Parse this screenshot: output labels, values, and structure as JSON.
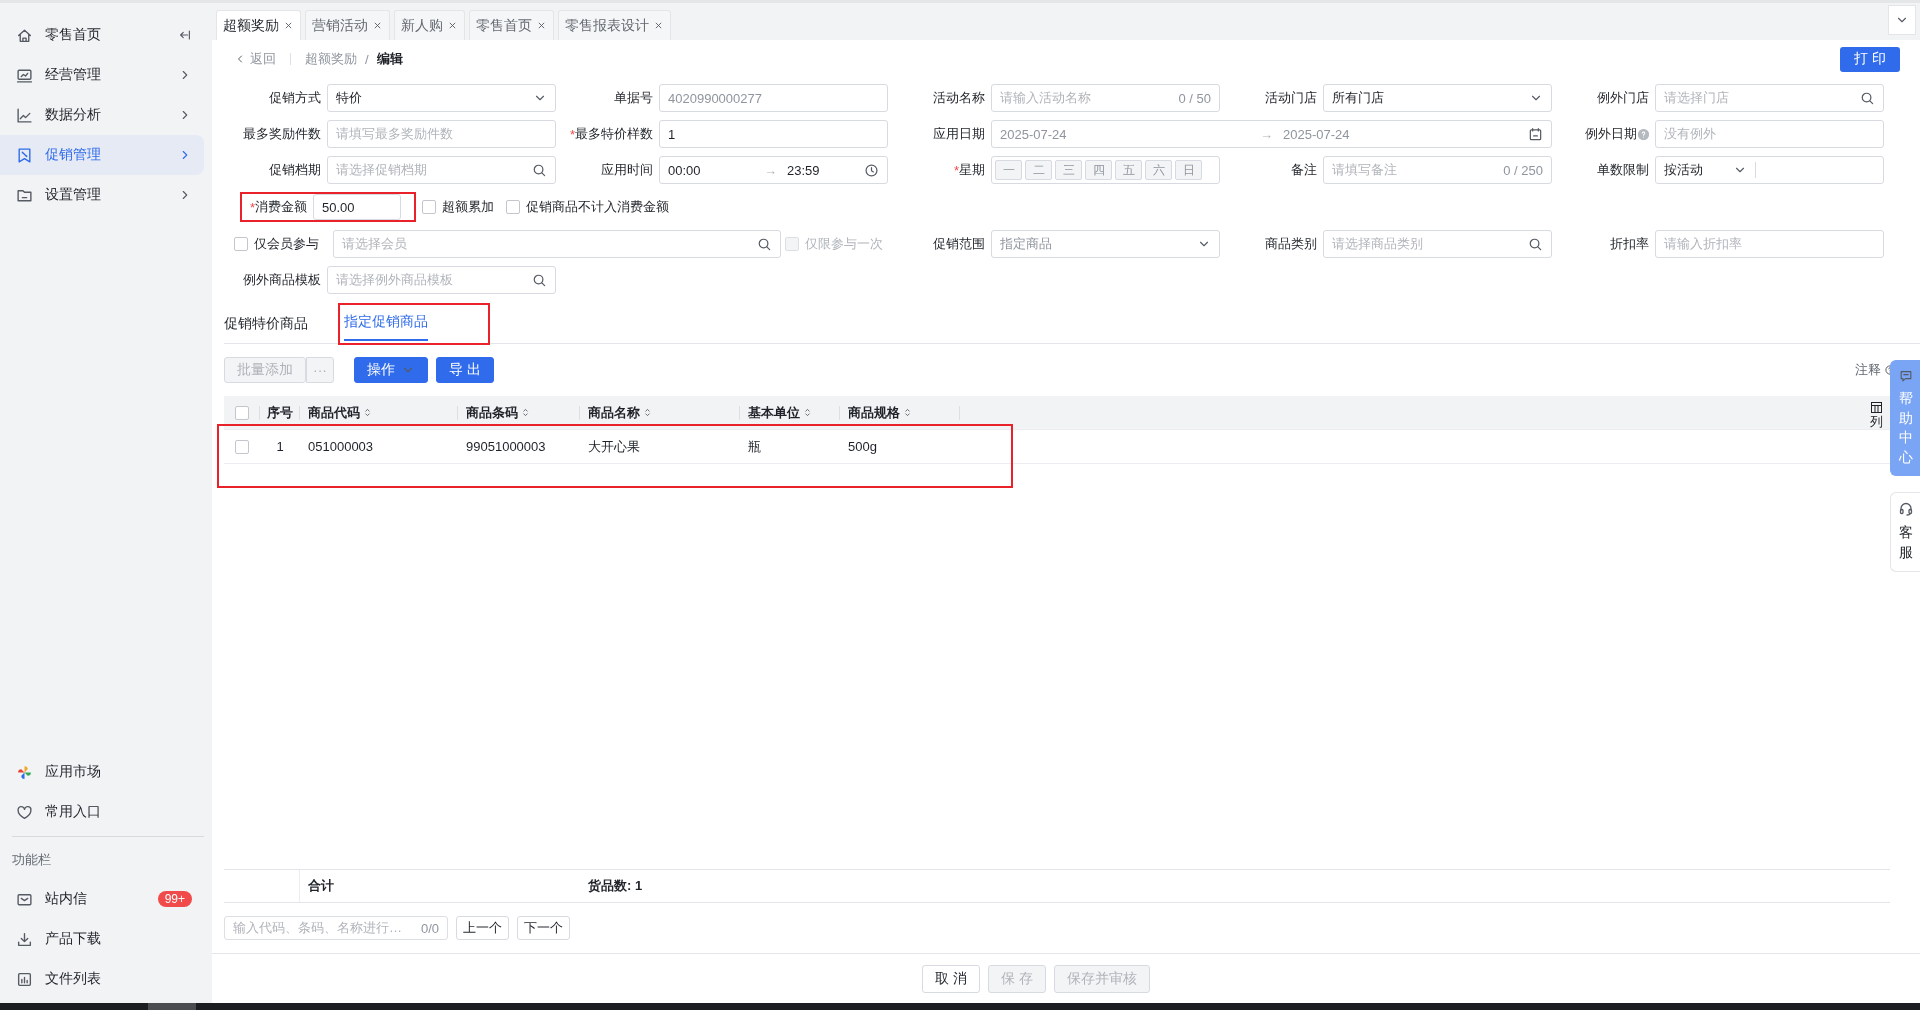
{
  "sidebar": {
    "nav": [
      {
        "label": "零售首页",
        "selected": false
      },
      {
        "label": "经营管理",
        "selected": false
      },
      {
        "label": "数据分析",
        "selected": false
      },
      {
        "label": "促销管理",
        "selected": true
      },
      {
        "label": "设置管理",
        "selected": false
      }
    ],
    "shortcuts": [
      {
        "label": "应用市场"
      },
      {
        "label": "常用入口"
      }
    ],
    "section_title": "功能栏",
    "tools": [
      {
        "label": "站内信",
        "badge": "99+"
      },
      {
        "label": "产品下载"
      },
      {
        "label": "文件列表"
      }
    ]
  },
  "tabs": [
    {
      "label": "超额奖励",
      "selected": true
    },
    {
      "label": "营销活动",
      "selected": false
    },
    {
      "label": "新人购",
      "selected": false
    },
    {
      "label": "零售首页",
      "selected": false
    },
    {
      "label": "零售报表设计",
      "selected": false
    }
  ],
  "breadcrumb": {
    "back": "返回",
    "items": [
      "超额奖励",
      "编辑"
    ],
    "separator": "/"
  },
  "print_button": "打 印",
  "form": {
    "rows": [
      [
        {
          "kind": "select",
          "label": "促销方式",
          "value": "特价"
        },
        {
          "kind": "input",
          "label": "单据号",
          "value": "4020990000277",
          "disabled": true
        },
        {
          "kind": "counter",
          "label": "活动名称",
          "placeholder": "请输入活动名称",
          "count": "0 / 50"
        },
        {
          "kind": "select",
          "label": "活动门店",
          "value": "所有门店"
        },
        {
          "kind": "search",
          "label": "例外门店",
          "placeholder": "请选择门店"
        }
      ],
      [
        {
          "kind": "input",
          "label": "最多奖励件数",
          "placeholder": "请填写最多奖励件数"
        },
        {
          "kind": "input",
          "label": "最多特价样数",
          "mark": "*",
          "value": "1"
        },
        {
          "kind": "daterange",
          "label": "应用日期",
          "start": "2025-07-24",
          "arrow": "→",
          "end": "2025-07-24"
        },
        "",
        "",
        {
          "kind": "input",
          "label": "例外日期",
          "help": true,
          "placeholder": "没有例外"
        }
      ],
      [
        {
          "kind": "search",
          "label": "促销档期",
          "placeholder": "请选择促销档期"
        },
        {
          "kind": "timerange",
          "label": "应用时间",
          "start": "00:00",
          "arrow": "→",
          "end": "23:59"
        },
        {
          "kind": "weekdays",
          "label": "星期",
          "mark": "*",
          "days": [
            "一",
            "二",
            "三",
            "四",
            "五",
            "六",
            "日"
          ]
        },
        {
          "kind": "counter",
          "label": "备注",
          "placeholder": "请填写备注",
          "count": "0 / 250"
        },
        {
          "kind": "split-select",
          "label": "单数限制",
          "value": "按活动"
        }
      ],
      [
        {
          "kind": "amount",
          "label": "消费金额",
          "mark": "*",
          "value": "50.00",
          "highlighted": true,
          "options": [
            {
              "label": "超额累加",
              "checked": false
            },
            {
              "label": "促销商品不计入消费金额",
              "checked": false
            }
          ]
        }
      ],
      [
        {
          "kind": "member",
          "label": "仅会员参与",
          "checked": false,
          "placeholder": "请选择会员"
        },
        {
          "kind": "checkbox",
          "label": "仅限参与一次",
          "checked": false,
          "disabled": true
        },
        {
          "kind": "select",
          "label": "促销范围",
          "value": "指定商品",
          "disabled": true
        },
        {
          "kind": "search",
          "label": "商品类别",
          "placeholder": "请选择商品类别"
        },
        {
          "kind": "input",
          "label": "折扣率",
          "placeholder": "请输入折扣率"
        }
      ],
      [
        {
          "kind": "search",
          "label": "例外商品模板",
          "placeholder": "请选择例外商品模板"
        }
      ]
    ]
  },
  "sub_tabs": [
    {
      "label": "促销特价商品",
      "selected": false,
      "highlighted": false
    },
    {
      "label": "指定促销商品",
      "selected": true,
      "highlighted": true
    }
  ],
  "toolbar": {
    "buttons": [
      {
        "kind": "default",
        "label": "批量添加",
        "disabled": true
      },
      {
        "kind": "more",
        "label": "···",
        "disabled": true
      },
      {
        "kind": "dropdown",
        "label": "操作",
        "disabled": false
      },
      {
        "kind": "primary",
        "label": "导 出",
        "disabled": false
      }
    ],
    "note": "注释"
  },
  "table": {
    "all_checked": false,
    "columns": [
      "序号",
      "商品代码",
      "商品条码",
      "商品名称",
      "基本单位",
      "商品规格"
    ],
    "rows": [
      {
        "checked": false,
        "highlighted": true,
        "cells": [
          "1",
          "051000003",
          "99051000003",
          "大开心果",
          "瓶",
          "500g"
        ]
      }
    ],
    "column_settings": "列",
    "footer": {
      "label": "合计",
      "count": "货品数: 1"
    }
  },
  "pager": {
    "placeholder": "输入代码、条码、名称进行…",
    "count": "0/0",
    "prev": "上一个",
    "next": "下一个"
  },
  "actions": [
    {
      "label": "取 消",
      "disabled": false
    },
    {
      "label": "保 存",
      "disabled": true
    },
    {
      "label": "保存并审核",
      "disabled": true
    }
  ],
  "side_tabs": [
    {
      "kind": "primary",
      "label": "帮助中心"
    },
    {
      "kind": "default",
      "label": "客服"
    }
  ]
}
